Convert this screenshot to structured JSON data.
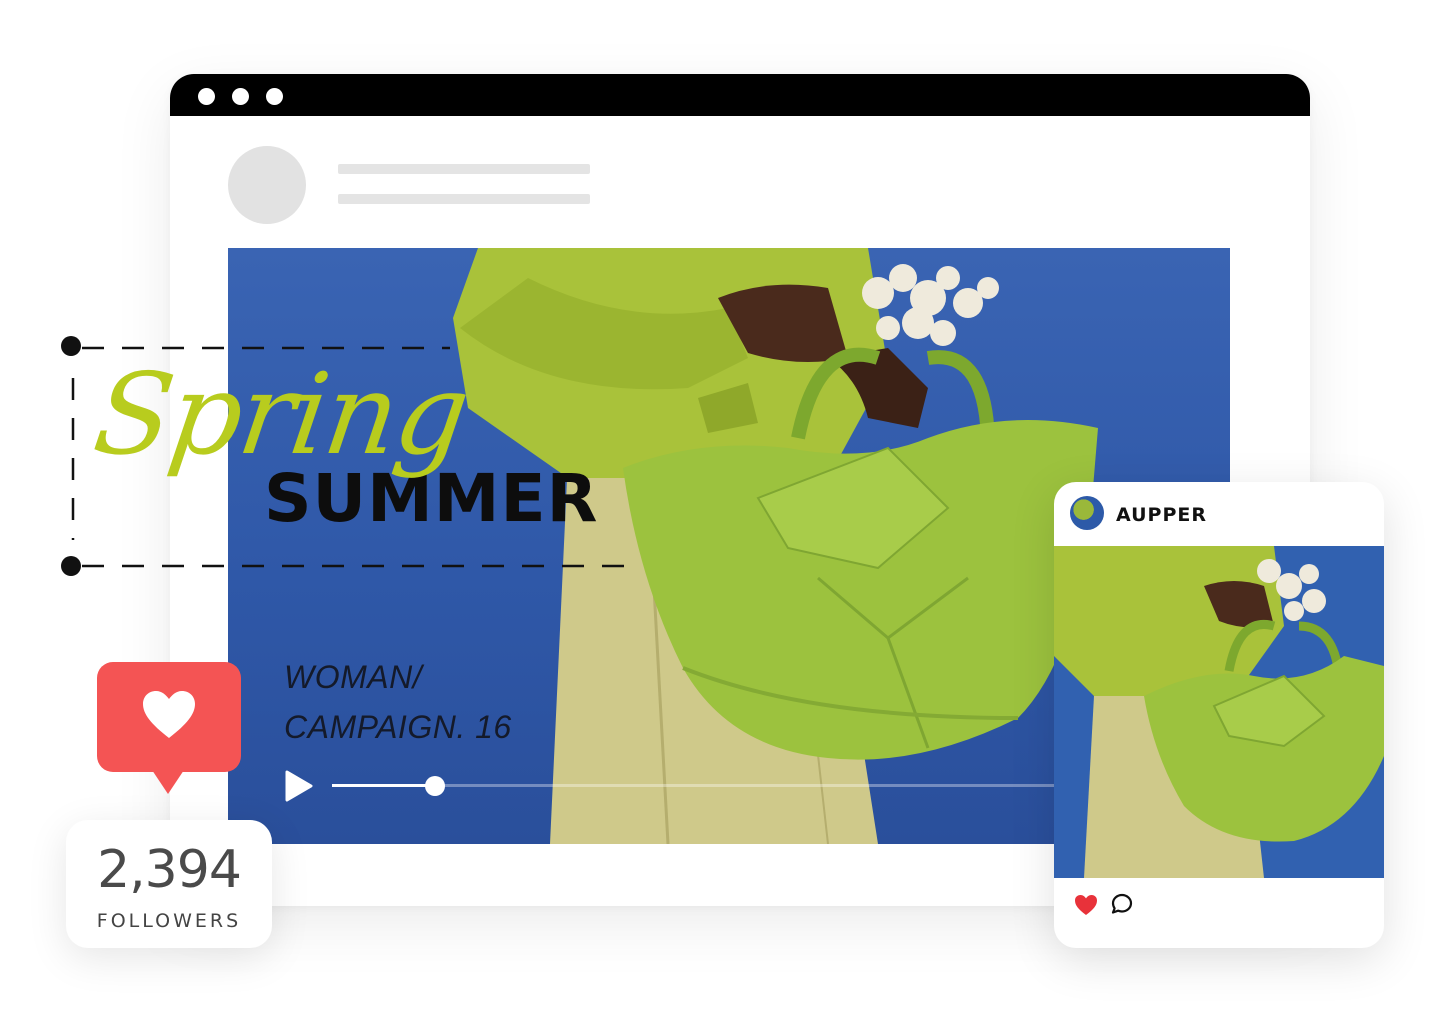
{
  "hero": {
    "script_word": "Spring",
    "headline": "SUMMER",
    "campaign_line1": "WOMAN/",
    "campaign_line2": "CAMPAIGN. 16",
    "playback_progress": 0.114
  },
  "like_badge": {
    "icon": "heart-icon",
    "color": "#f45454"
  },
  "followers": {
    "count": "2,394",
    "label": "FOLLOWERS"
  },
  "post": {
    "username": "AUPPER",
    "like_icon": "heart-icon",
    "comment_icon": "comment-icon"
  },
  "colors": {
    "accent_lime": "#b8cc1e",
    "hero_blue": "#2f58a8",
    "like_red": "#f45454",
    "heart_red": "#e8323a"
  }
}
